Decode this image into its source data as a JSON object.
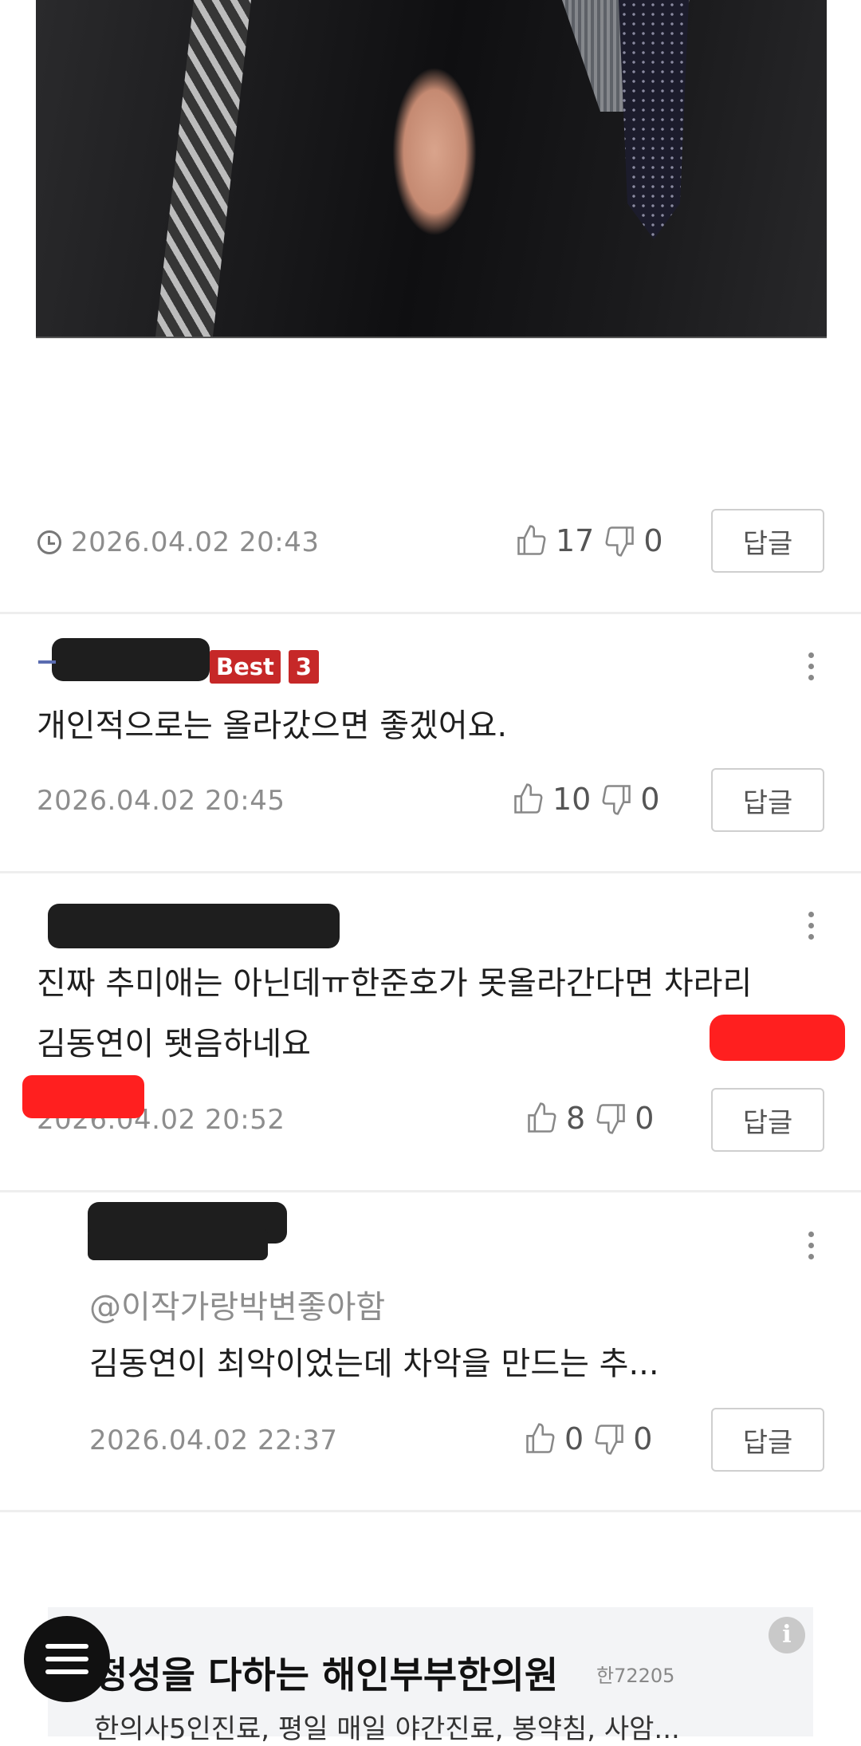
{
  "post": {
    "photo_alt": "",
    "date": "2026.04.02 20:43",
    "likes": "17",
    "dislikes": "0",
    "reply_label": "답글"
  },
  "comments": [
    {
      "best_label": "Best",
      "best_rank": "3",
      "text_lines": [
        "개인적으로는 올라갔으면 좋겠어요."
      ],
      "date": "2026.04.02 20:45",
      "likes": "10",
      "dislikes": "0",
      "reply_label": "답글"
    },
    {
      "text_lines": [
        "진짜 추미애는 아닌데ㅠ한준호가 못올라간다면 차라리",
        "김동연이 됏음하네요"
      ],
      "date": "2026.04.02 20:52",
      "likes": "8",
      "dislikes": "0",
      "reply_label": "답글"
    },
    {
      "mention": "@이작가랑박변좋아함",
      "text_lines": [
        "김동연이 최악이었는데 차악을 만드는 추..."
      ],
      "date": "2026.04.02 22:37",
      "likes": "0",
      "dislikes": "0",
      "reply_label": "답글"
    }
  ],
  "ad": {
    "title": "정성을 다하는 해인부부한의원",
    "tag": "한72205",
    "description": "한의사5인진료, 평일 매일 야간진료, 봉약침, 사암...",
    "info_icon": "i"
  },
  "colors": {
    "badge": "#c62828",
    "redaction_red": "#ff1f1f",
    "redaction_black": "#1e1e1e"
  }
}
